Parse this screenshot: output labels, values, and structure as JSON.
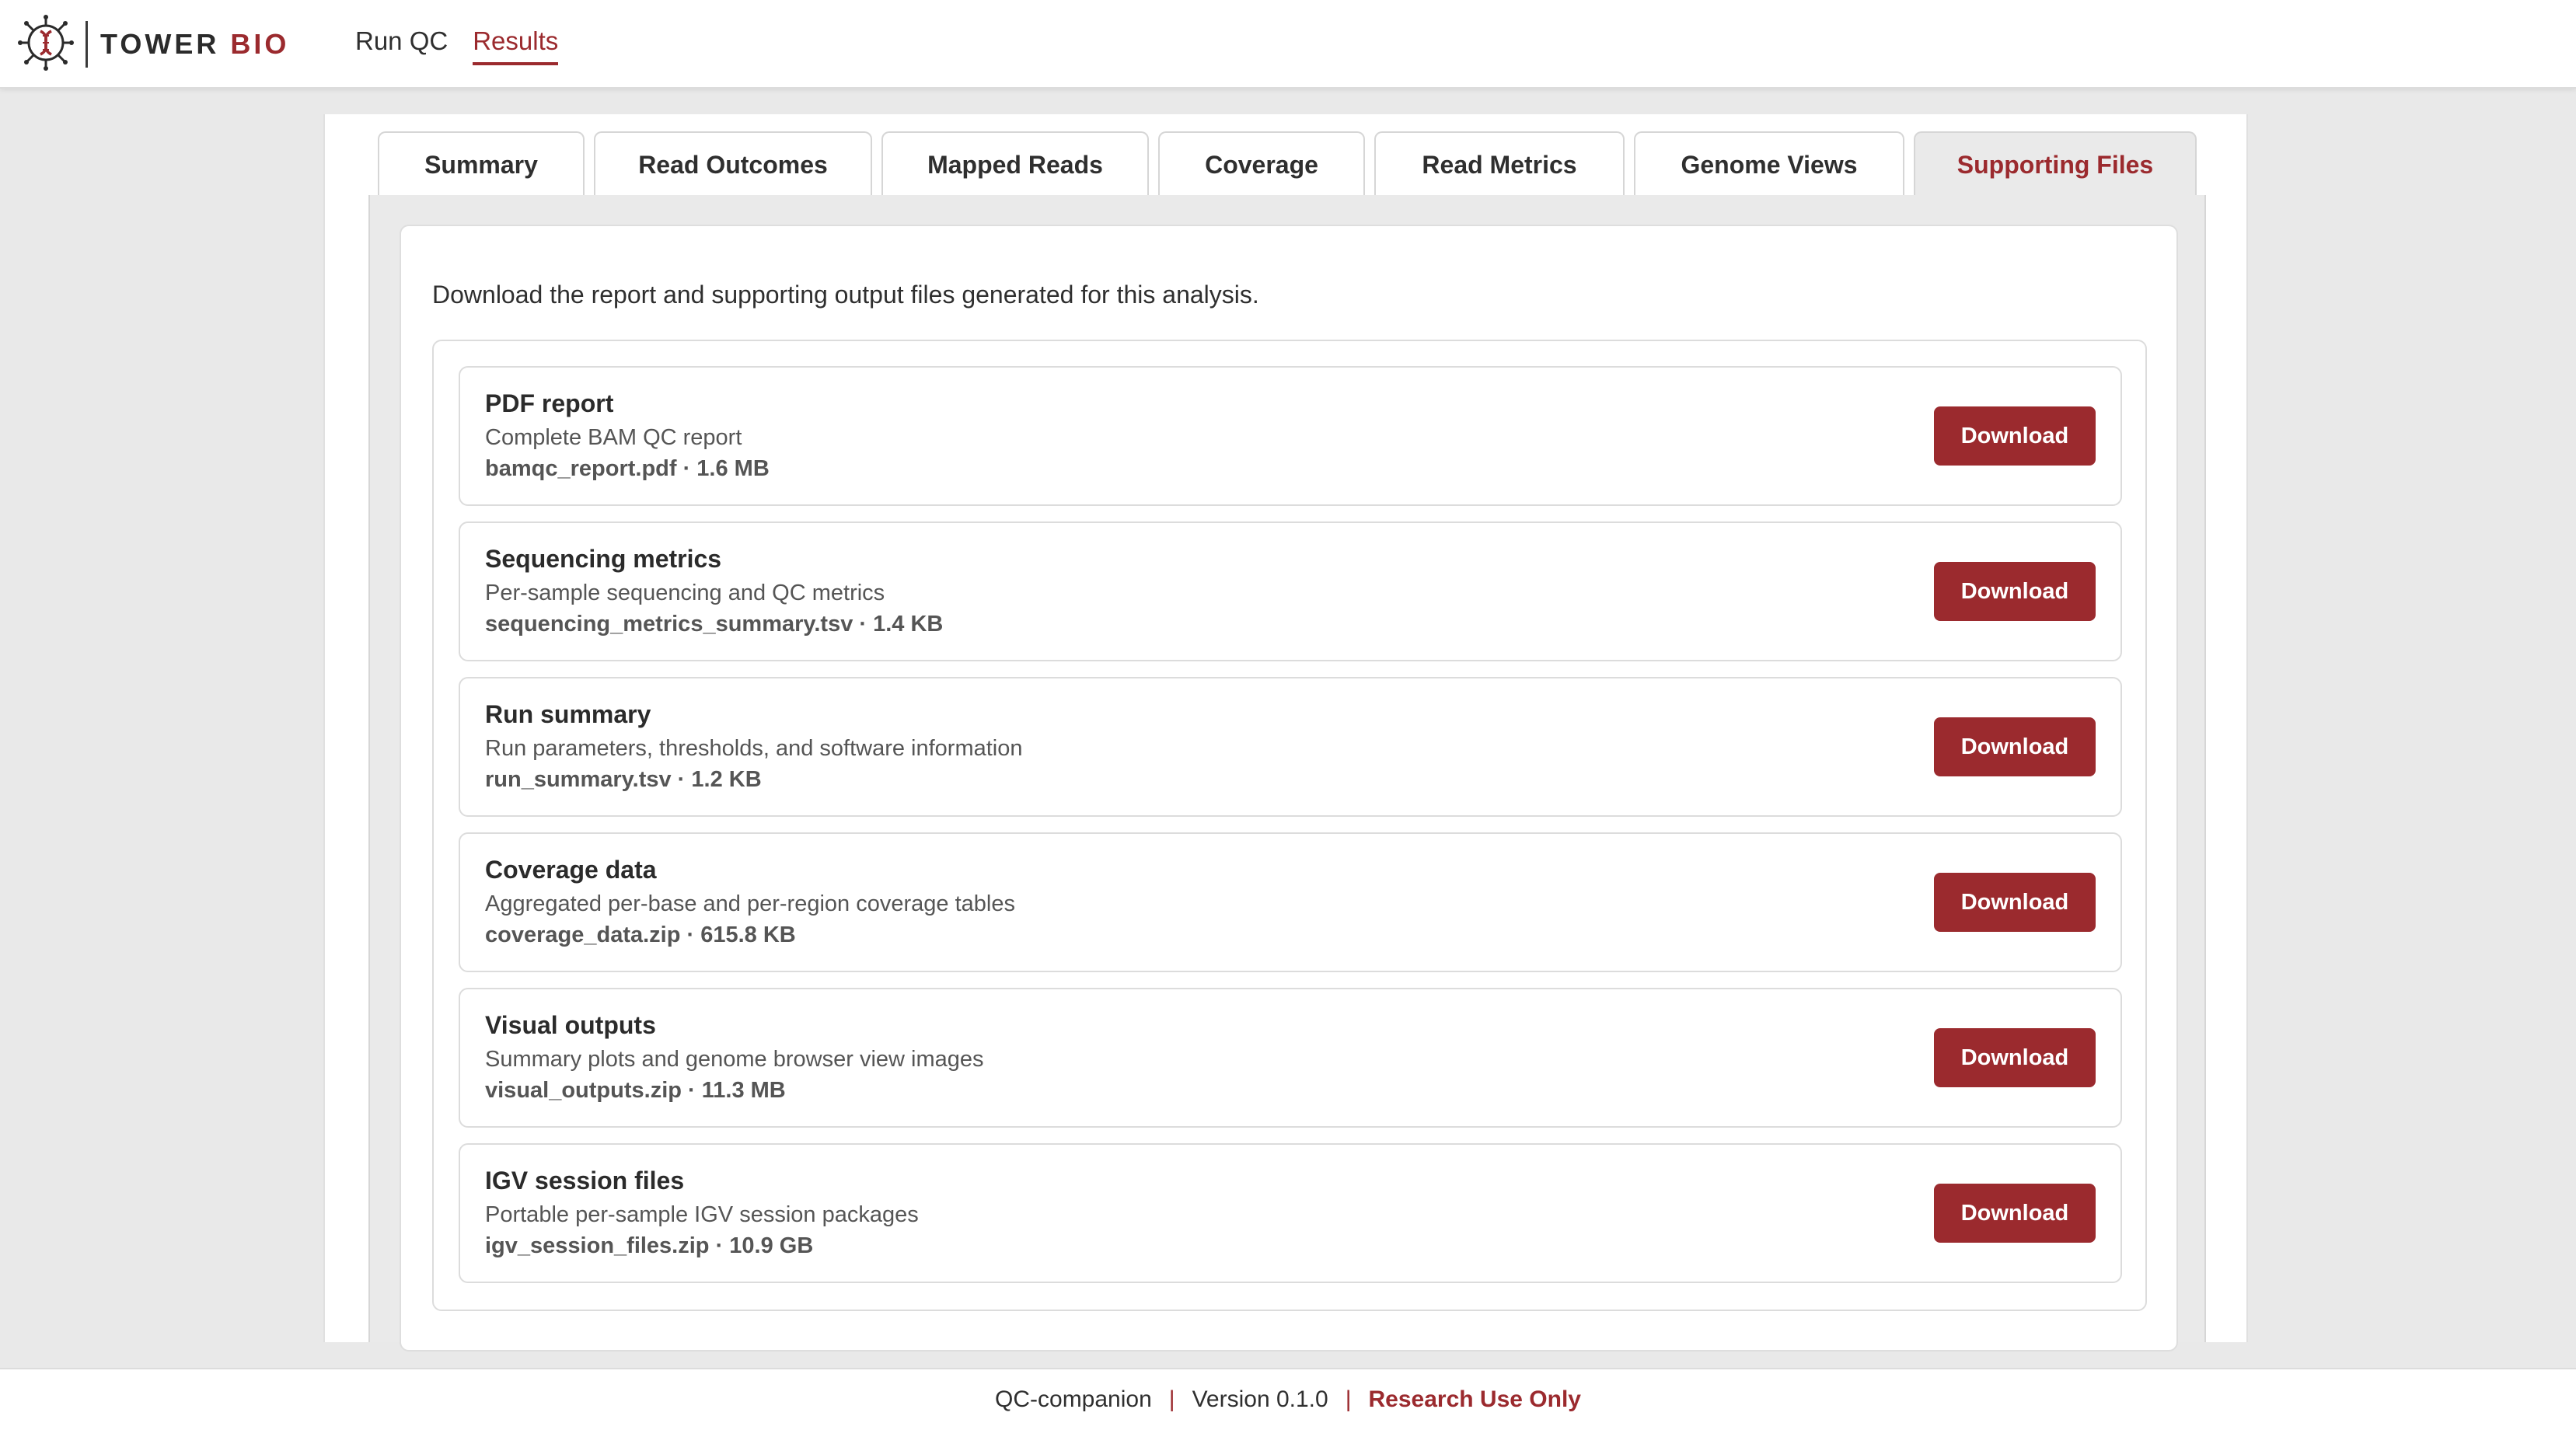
{
  "brand": {
    "name_part1": "TOWER ",
    "name_part2": "BIO",
    "logo_icon": "dna-helix-logo-icon",
    "accent_color": "#9b2a2e"
  },
  "nav": {
    "items": [
      {
        "label": "Run QC",
        "active": false
      },
      {
        "label": "Results",
        "active": true
      }
    ]
  },
  "tabs": [
    {
      "label": "Summary",
      "active": false
    },
    {
      "label": "Read Outcomes",
      "active": false
    },
    {
      "label": "Mapped Reads",
      "active": false
    },
    {
      "label": "Coverage",
      "active": false
    },
    {
      "label": "Read Metrics",
      "active": false
    },
    {
      "label": "Genome Views",
      "active": false
    },
    {
      "label": "Supporting Files",
      "active": true
    }
  ],
  "supporting_files": {
    "intro": "Download the report and supporting output files generated for this analysis.",
    "files": [
      {
        "title": "PDF report",
        "description": "Complete BAM QC report",
        "meta": "bamqc_report.pdf · 1.6 MB",
        "button": "Download"
      },
      {
        "title": "Sequencing metrics",
        "description": "Per-sample sequencing and QC metrics",
        "meta": "sequencing_metrics_summary.tsv · 1.4 KB",
        "button": "Download"
      },
      {
        "title": "Run summary",
        "description": "Run parameters, thresholds, and software information",
        "meta": "run_summary.tsv · 1.2 KB",
        "button": "Download"
      },
      {
        "title": "Coverage data",
        "description": "Aggregated per-base and per-region coverage tables",
        "meta": "coverage_data.zip · 615.8 KB",
        "button": "Download"
      },
      {
        "title": "Visual outputs",
        "description": "Summary plots and genome browser view images",
        "meta": "visual_outputs.zip · 11.3 MB",
        "button": "Download"
      },
      {
        "title": "IGV session files",
        "description": "Portable per-sample IGV session packages",
        "meta": "igv_session_files.zip · 10.9 GB",
        "button": "Download"
      }
    ]
  },
  "footer": {
    "app_name": "QC-companion",
    "separator": "|",
    "version": "Version 0.1.0",
    "notice": "Research Use Only"
  }
}
